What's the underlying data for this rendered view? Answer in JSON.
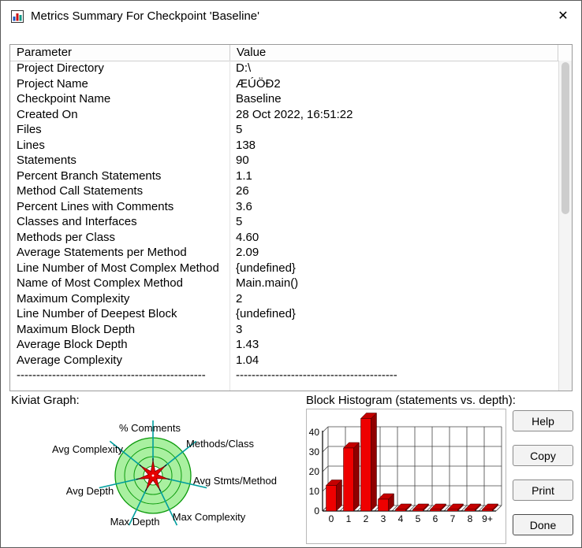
{
  "window": {
    "title": "Metrics Summary For Checkpoint 'Baseline'",
    "close_glyph": "✕"
  },
  "table": {
    "columns": [
      "Parameter",
      "Value"
    ],
    "rows": [
      [
        "Project Directory",
        "D:\\"
      ],
      [
        "Project Name",
        "ÆÚÖÐ2"
      ],
      [
        "Checkpoint Name",
        "Baseline"
      ],
      [
        "Created On",
        "28 Oct 2022, 16:51:22"
      ],
      [
        "Files",
        "5"
      ],
      [
        "Lines",
        "138"
      ],
      [
        "Statements",
        "90"
      ],
      [
        "Percent Branch Statements",
        "1.1"
      ],
      [
        "Method Call Statements",
        "26"
      ],
      [
        "Percent Lines with Comments",
        "3.6"
      ],
      [
        "Classes and Interfaces",
        "5"
      ],
      [
        "Methods per Class",
        "4.60"
      ],
      [
        "Average Statements per Method",
        "2.09"
      ],
      [
        "Line Number of Most Complex Method",
        "{undefined}"
      ],
      [
        "Name of Most Complex Method",
        "Main.main()"
      ],
      [
        "Maximum Complexity",
        "2"
      ],
      [
        "Line Number of Deepest Block",
        "{undefined}"
      ],
      [
        "Maximum Block Depth",
        "3"
      ],
      [
        "Average Block Depth",
        "1.43"
      ],
      [
        "Average Complexity",
        "1.04"
      ],
      [
        "------------------------------------------------",
        "-----------------------------------------"
      ]
    ]
  },
  "kiviat": {
    "label": "Kiviat Graph:"
  },
  "histogram": {
    "label": "Block Histogram (statements vs. depth):"
  },
  "buttons": {
    "help": "Help",
    "copy": "Copy",
    "print": "Print",
    "done": "Done"
  },
  "chart_data": [
    {
      "type": "radar",
      "title": "Kiviat Graph",
      "axes": [
        "% Comments",
        "Methods/Class",
        "Avg Stmts/Method",
        "Max Complexity",
        "Max Depth",
        "Avg Depth",
        "Avg Complexity"
      ]
    },
    {
      "type": "bar",
      "title": "Block Histogram (statements vs. depth)",
      "categories": [
        "0",
        "1",
        "2",
        "3",
        "4",
        "5",
        "6",
        "7",
        "8",
        "9+"
      ],
      "values": [
        13,
        32,
        47,
        6,
        0,
        0,
        0,
        0,
        0,
        0
      ],
      "xlabel": "depth",
      "ylabel": "statements",
      "ylim": [
        0,
        40
      ],
      "yticks": [
        0,
        10,
        20,
        30,
        40
      ]
    }
  ],
  "colors": {
    "bar_red": "#ee0000",
    "bar_top": "#c40000",
    "bar_side": "#8f0000",
    "kiviat_green": "#a9f0a0",
    "ring_green": "#0b9a0b",
    "axis_teal": "#009e9e"
  }
}
